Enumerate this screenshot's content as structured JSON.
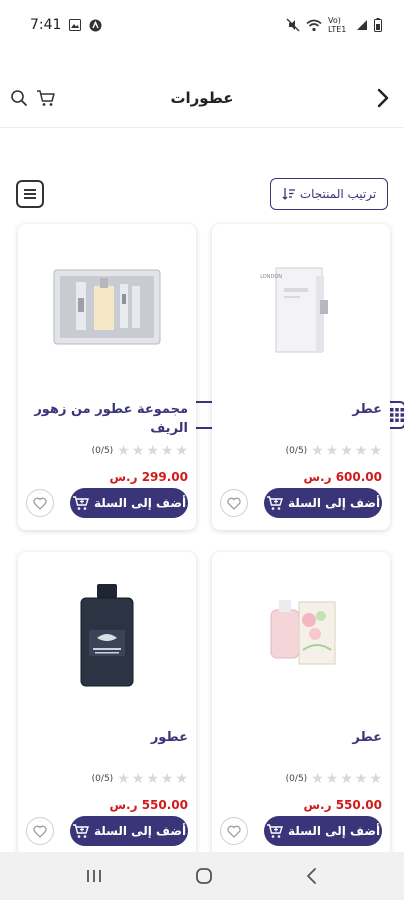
{
  "status_bar": {
    "time": "7:41",
    "network": "Vo) LTE1"
  },
  "header": {
    "title": "عطورات"
  },
  "toolbar": {
    "sort_label": "ترتيب المنتجات"
  },
  "products": [
    {
      "name": "عطر",
      "rating_text": "(0/5)",
      "price": "600.00 ر.س",
      "add_label": "أضف إلى السلة"
    },
    {
      "name": "مجموعة عطور من زهور الريف",
      "rating_text": "(0/5)",
      "price": "299.00 ر.س",
      "add_label": "أضف إلى السلة"
    },
    {
      "name": "عطر",
      "rating_text": "(0/5)",
      "price": "550.00 ر.س",
      "add_label": "أضف إلى السلة"
    },
    {
      "name": "عطور",
      "rating_text": "(0/5)",
      "price": "550.00 ر.س",
      "add_label": "أضف إلى السلة"
    }
  ],
  "colors": {
    "brand": "#3a3579",
    "price": "#d11a1a",
    "star_empty": "#d8d8d8"
  },
  "icons": [
    "back-arrow-icon",
    "cart-icon",
    "search-icon",
    "list-view-icon",
    "grid-view-icon",
    "sort-icon",
    "heart-icon",
    "add-to-cart-icon"
  ]
}
